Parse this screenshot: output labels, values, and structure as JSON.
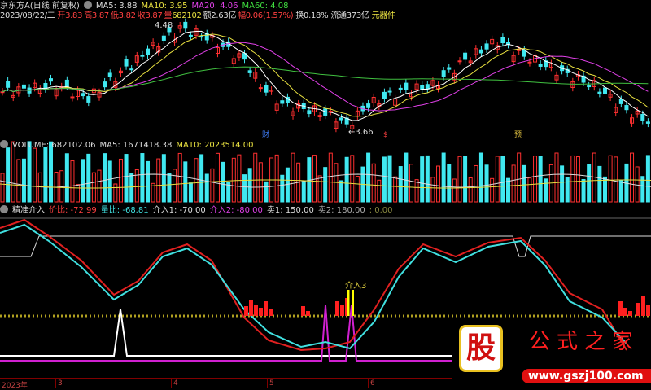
{
  "price_header": {
    "name": "京东方A",
    "period": "(日线 前复权)",
    "ma5": "MA5: 3.88",
    "ma10": "MA10: 3.95",
    "ma20": "MA20: 4.06",
    "ma60": "MA60: 4.08"
  },
  "quote": {
    "date": "2023/08/22/二",
    "open_label": "开",
    "open": "3.83",
    "high_label": "高",
    "high": "3.87",
    "low_label": "低",
    "low": "3.82",
    "close_label": "收",
    "close": "3.87",
    "vol_label": "量",
    "vol": "682102",
    "amt_label": "额",
    "amt": "2.63亿",
    "chg_label": "幅",
    "chg": "0.06(1.57%)",
    "turnover": "换0.18%",
    "float": "流通373亿",
    "sector": "元器件"
  },
  "annotations": {
    "high": "4.48",
    "low": "3.66",
    "tag_cai": "财",
    "tag_s": "$",
    "tag_yu": "预"
  },
  "volume_header": {
    "label": "VOLUME: 682102.06",
    "ma5": "MA5: 1671418.38",
    "ma10": "MA10: 2023514.00"
  },
  "indicator_header": {
    "name": "精准介入",
    "jiabi": "价比: -72.99",
    "liangbi": "量比: -68.81",
    "jieru1": "介入1: -70.00",
    "jieru2": "介入2: -80.00",
    "mai1": "卖1: 150.00",
    "mai2": "卖2: 180.00",
    "extra": ": 0.00"
  },
  "indicator_label": "介入3",
  "axis": {
    "year": "2023年",
    "m3": "3",
    "m4": "4",
    "m5": "5",
    "m6": "6"
  },
  "watermark": {
    "char": "股",
    "name": "公式之家",
    "url": "www.gszj100.com"
  },
  "colors": {
    "up": "#ff3030",
    "down": "#40e8f0",
    "ma5": "#ffffff",
    "ma10": "#e8e040",
    "ma20": "#e040e8",
    "ma60": "#40c040"
  }
}
